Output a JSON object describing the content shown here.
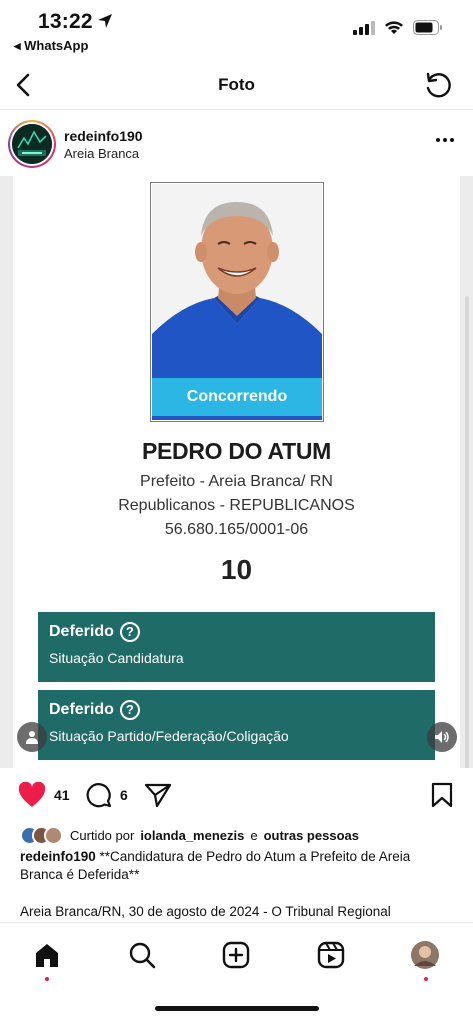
{
  "status_bar": {
    "time": "13:22",
    "back_app": "◂ WhatsApp"
  },
  "nav": {
    "title": "Foto"
  },
  "post": {
    "username": "redeinfo190",
    "location": "Areia Branca"
  },
  "candidate": {
    "status_chip": "Concorrendo",
    "name": "PEDRO DO ATUM",
    "office": "Prefeito - Areia Branca/ RN",
    "party": "Republicanos - REPUBLICANOS",
    "cnpj": "56.680.165/0001-06",
    "number": "10",
    "statuses": [
      {
        "title": "Deferido",
        "subtitle": "Situação Candidatura"
      },
      {
        "title": "Deferido",
        "subtitle": "Situação Partido/Federação/Coligação"
      }
    ]
  },
  "actions": {
    "likes": "41",
    "comments": "6"
  },
  "liked_by": {
    "prefix": "Curtido por",
    "user": "iolanda_menezis",
    "middle": "e",
    "others": "outras pessoas"
  },
  "caption": {
    "user": "redeinfo190",
    "text": "**Candidatura de Pedro do Atum a Prefeito de Areia Branca é Deferida**",
    "more": "Areia Branca/RN, 30 de agosto de 2024 - O Tribunal Regional"
  },
  "colors": {
    "accent_teal": "#1f6b68",
    "chip_blue": "#2bb6e4",
    "like_red": "#ed1c4b"
  },
  "icons": [
    "location-arrow-icon",
    "signal-icon",
    "wifi-icon",
    "battery-icon",
    "back-chevron-icon",
    "refresh-icon",
    "more-icon",
    "help-circle-icon",
    "user-tag-icon",
    "sound-icon",
    "heart-icon",
    "comment-icon",
    "share-icon",
    "bookmark-icon",
    "home-icon",
    "search-icon",
    "create-icon",
    "reels-icon",
    "profile-avatar"
  ]
}
